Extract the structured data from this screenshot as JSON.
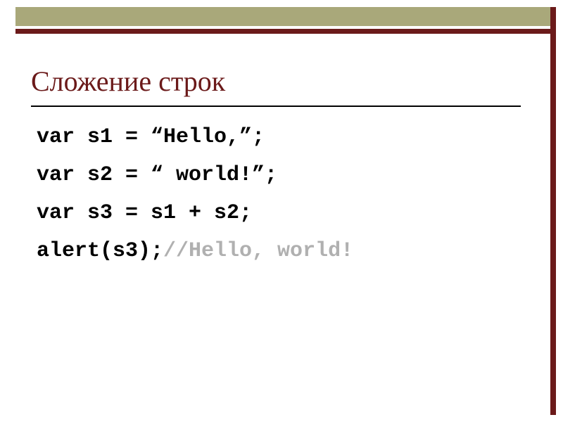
{
  "slide": {
    "title": "Сложение строк",
    "code": {
      "line1": "var s1 = “Hello,”;",
      "line2": "var s2 = “ world!”;",
      "line3": "var s3 = s1 + s2;",
      "line4_code": "alert(s3);",
      "line4_comment": "//Hello, world!"
    }
  },
  "colors": {
    "accent_olive": "#a9a87a",
    "accent_dark_red": "#6b1a1a",
    "comment_gray": "#b0b0b0"
  }
}
